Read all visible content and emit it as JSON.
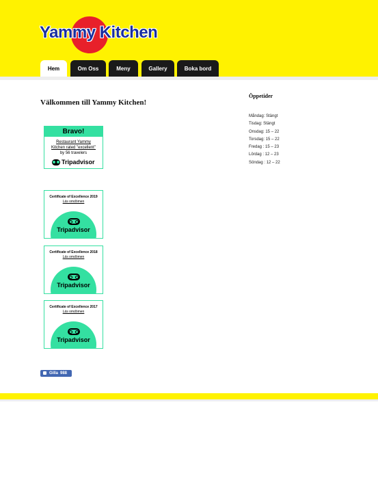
{
  "header": {
    "logo_text": "Yammy Kitchen",
    "colors": {
      "brand_yellow": "#fff200",
      "logo_red": "#e8202a",
      "logo_blue": "#1a2fa0"
    }
  },
  "nav": {
    "items": [
      {
        "label": "Hem",
        "active": true
      },
      {
        "label": "Om Oss",
        "active": false
      },
      {
        "label": "Meny",
        "active": false
      },
      {
        "label": "Gallery",
        "active": false
      },
      {
        "label": "Boka bord",
        "active": false
      }
    ]
  },
  "main": {
    "title": "Välkommen till Yammy Kitchen!",
    "badge": {
      "heading": "Bravo!",
      "line1": "Restaurant Yammy",
      "line2": "Kitchen rated \"excellent\"",
      "line3": "by 56 travelers",
      "brand": "Tripadvisor"
    },
    "certificates": [
      {
        "title": "Certificate of Excellence 2019",
        "link": "Läs omdömen",
        "brand": "Tripadvisor"
      },
      {
        "title": "Certificate of Excellence 2018",
        "link": "Läs omdömen",
        "brand": "Tripadvisor"
      },
      {
        "title": "Certificate of Excellence 2017",
        "link": "Läs omdömen",
        "brand": "Tripadvisor"
      }
    ],
    "like": {
      "label": "Gilla",
      "count": "988"
    }
  },
  "sidebar": {
    "title": "Öppetider",
    "hours": [
      "Måndag: Stängt",
      "Tisdag: Stängt",
      "Onsdag: 15 – 22",
      "Torsdag: 15 – 22",
      "Fredag : 15 – 23",
      "Lördag : 12 – 23",
      "Söndag : 12 – 22"
    ]
  }
}
